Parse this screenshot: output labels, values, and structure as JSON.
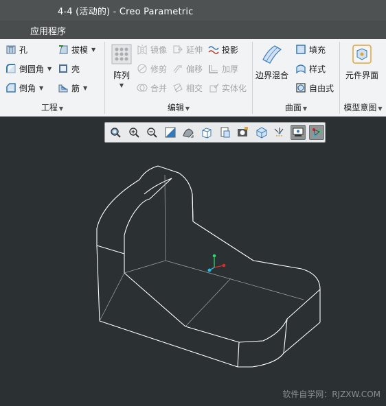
{
  "window": {
    "title": "4-4 (活动的) - Creo Parametric"
  },
  "menubar": {
    "app_menu": "应用程序"
  },
  "ribbon": {
    "engineering": {
      "label": "工程",
      "hole": "孔",
      "round": "倒圆角",
      "chamfer": "倒角",
      "draft": "拔模",
      "shell": "壳",
      "rib": "筋"
    },
    "editing": {
      "label": "编辑",
      "pattern": "阵列",
      "mirror": "镜像",
      "extend": "延伸",
      "project": "投影",
      "trim": "修剪",
      "offset": "偏移",
      "thicken": "加厚",
      "merge": "合并",
      "intersect": "相交",
      "solidify": "实体化"
    },
    "surfaces": {
      "label": "曲面",
      "boundary_blend": "边界混合",
      "fill": "填充",
      "style": "样式",
      "freestyle": "自由式"
    },
    "model_intent": {
      "label": "模型意图",
      "component_interface": "元件界面"
    }
  },
  "view_toolbar": {
    "icons": [
      "refit-icon",
      "zoom-in-icon",
      "zoom-out-icon",
      "repaint-icon",
      "display-style-icon",
      "saved-orientations-icon",
      "view-manager-icon",
      "perspective-view-icon",
      "spin-center-icon",
      "datum-display-icon",
      "annotation-display-icon",
      "spin-center-toggle-icon"
    ]
  },
  "watermark": "软件自学网：RJZXW.COM",
  "colors": {
    "viewport_bg": "#2b3032",
    "edge": "#ffffff",
    "axis_x": "#e02a2a",
    "axis_y": "#2bd36b",
    "axis_z": "#2ab8e0"
  }
}
